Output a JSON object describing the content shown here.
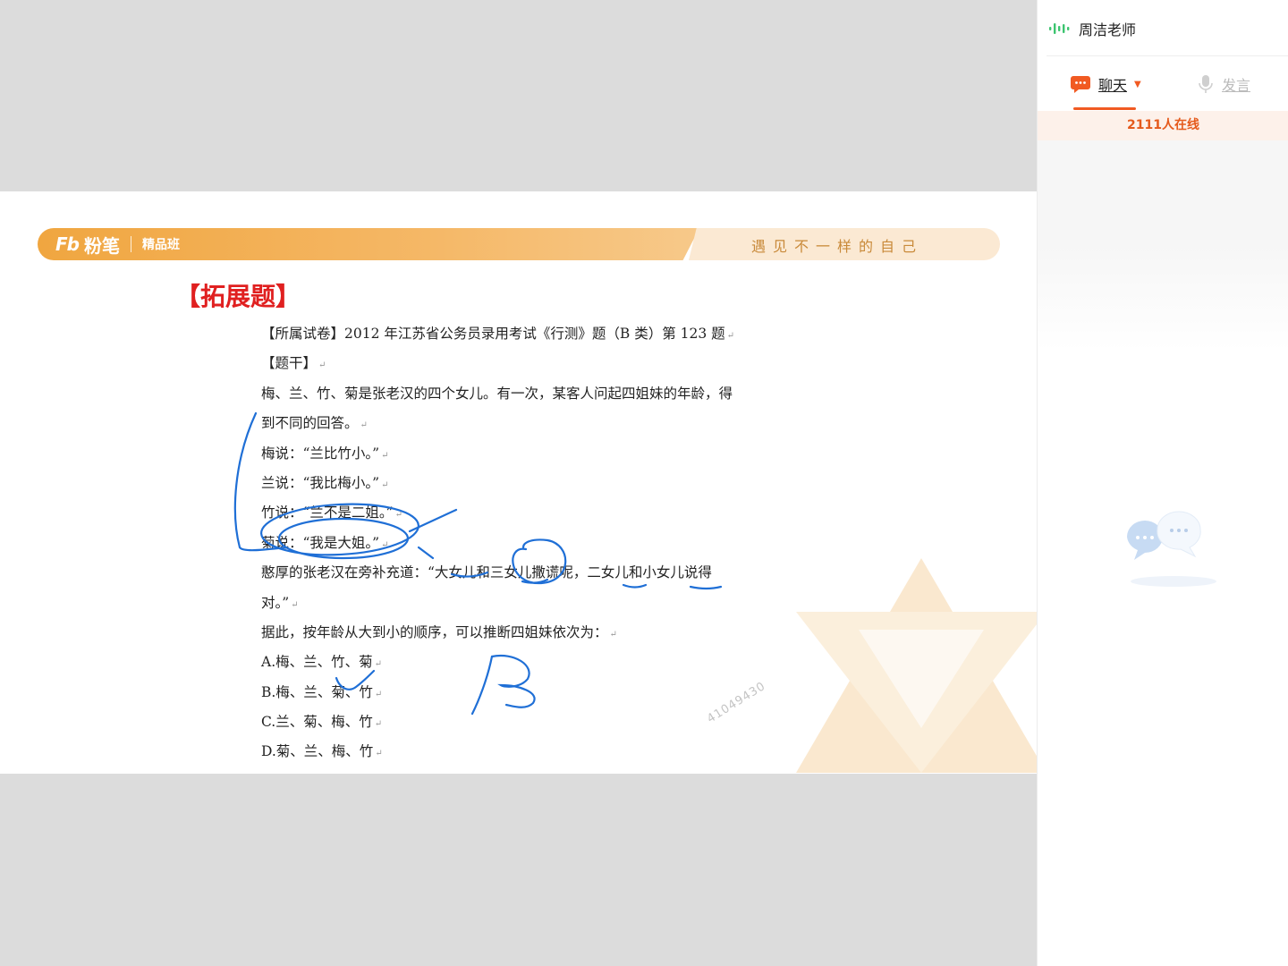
{
  "slide": {
    "brand_mark": "Fb",
    "brand_name": "粉笔",
    "class_label": "精品班",
    "slogan": "遇见不一样的自己",
    "section_title": "【拓展题】",
    "lines": [
      "【所属试卷】2012 年江苏省公务员录用考试《行测》题（B 类）第 123 题",
      "【题干】",
      "梅、兰、竹、菊是张老汉的四个女儿。有一次，某客人问起四姐妹的年龄，得",
      "到不同的回答。",
      "梅说：“兰比竹小。”",
      "兰说：“我比梅小。”",
      "竹说：“兰不是二姐。”",
      "菊说：“我是大姐。”",
      "憨厚的张老汉在旁补充道：“大女儿和三女儿撒谎呢，二女儿和小女儿说得",
      "对。”",
      "据此，按年龄从大到小的顺序，可以推断四姐妹依次为：",
      "A.梅、兰、竹、菊",
      "B.梅、兰、菊、竹",
      "C.兰、菊、梅、竹",
      "D.菊、兰、梅、竹"
    ],
    "return_mark": "↵",
    "watermark": "41049430",
    "handwritten_answer": "B"
  },
  "panel": {
    "teacher_name": "周洁老师",
    "tab_chat": "聊天",
    "tab_speak": "发言",
    "online_count": "2111人在线"
  },
  "colors": {
    "accent": "#f15a22",
    "banner": "#f0a640",
    "title_red": "#e02020",
    "ink_blue": "#1f6fd6"
  },
  "icons": [
    "audio-wave-icon",
    "chat-bubble-icon",
    "caret-down-icon",
    "microphone-icon",
    "empty-chat-icon"
  ]
}
